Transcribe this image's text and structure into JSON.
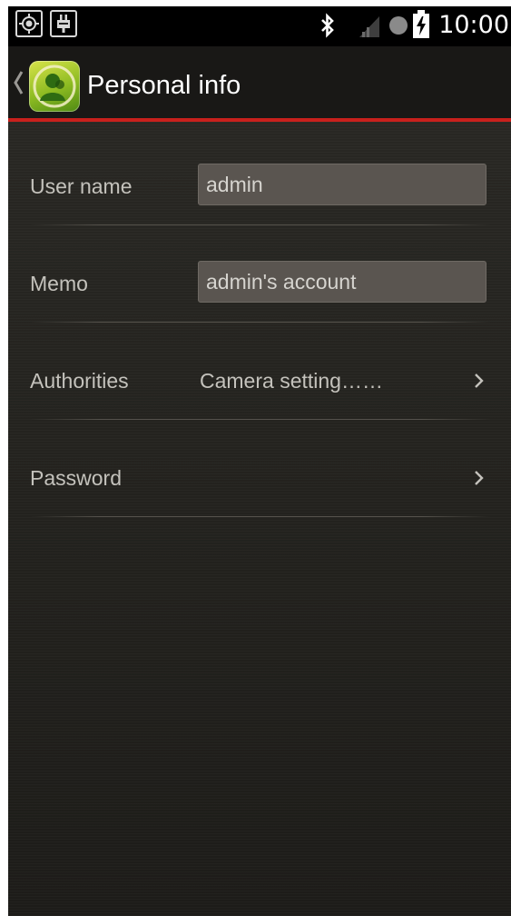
{
  "status_bar": {
    "time": "10:00",
    "icons": [
      "gps-icon",
      "usb-debug-icon",
      "bluetooth-icon",
      "signal-icon",
      "record-dot-icon",
      "battery-charging-icon"
    ]
  },
  "action_bar": {
    "title": "Personal info",
    "back_icon": "chevron-left-icon",
    "app_icon": "user-avatar-icon",
    "accent_color": "#c8201c"
  },
  "form": {
    "rows": [
      {
        "label": "User name",
        "value": "admin",
        "type": "input"
      },
      {
        "label": "Memo",
        "value": "admin's account",
        "type": "input"
      },
      {
        "label": "Authorities",
        "value": "Camera setting……",
        "type": "link"
      },
      {
        "label": "Password",
        "value": "",
        "type": "link"
      }
    ]
  }
}
